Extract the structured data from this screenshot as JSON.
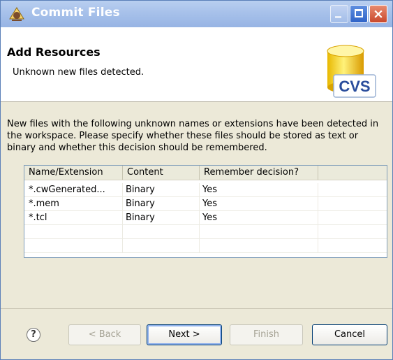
{
  "window": {
    "title": "Commit Files"
  },
  "header": {
    "title": "Add Resources",
    "description": "Unknown new files detected.",
    "logo_text": "CVS"
  },
  "body": {
    "instructions": "New files with the following unknown names or extensions have been detected in the workspace. Please specify whether these files should be stored as text or binary and whether this decision should be remembered."
  },
  "table": {
    "columns": [
      "Name/Extension",
      "Content",
      "Remember decision?",
      ""
    ],
    "rows": [
      [
        "*.cwGenerated...",
        "Binary",
        "Yes",
        ""
      ],
      [
        "*.mem",
        "Binary",
        "Yes",
        ""
      ],
      [
        "*.tcl",
        "Binary",
        "Yes",
        ""
      ],
      [
        "",
        "",
        "",
        ""
      ],
      [
        "",
        "",
        "",
        ""
      ]
    ]
  },
  "footer": {
    "help_symbol": "?",
    "back_label": "< Back",
    "next_label": "Next >",
    "finish_label": "Finish",
    "cancel_label": "Cancel"
  },
  "colors": {
    "titlebar": "#a7c1ea",
    "header_bg": "#ffffff",
    "dialog_bg": "#ece9d8",
    "button_border": "#003c74"
  },
  "icons": {
    "title": "eclipse-cvs-icon",
    "header": "cvs-cylinder-icon",
    "help": "help-icon"
  }
}
